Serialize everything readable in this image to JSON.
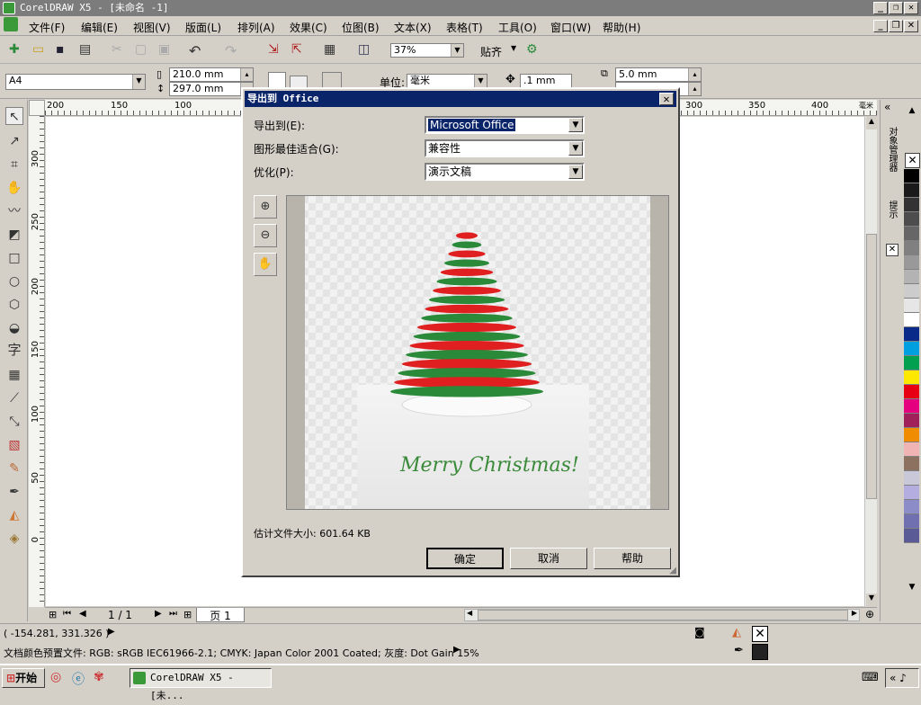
{
  "window": {
    "title": "CorelDRAW X5 - [未命名 -1]"
  },
  "menu": [
    "文件(F)",
    "编辑(E)",
    "视图(V)",
    "版面(L)",
    "排列(A)",
    "效果(C)",
    "位图(B)",
    "文本(X)",
    "表格(T)",
    "工具(O)",
    "窗口(W)",
    "帮助(H)"
  ],
  "toolbar": {
    "zoom": "37%",
    "snap_label": "贴齐"
  },
  "propbar": {
    "page_size": "A4",
    "width": "210.0 mm",
    "height": "297.0 mm",
    "units_label": "单位:",
    "units": "毫米",
    "nudge": ".1 mm",
    "dup_x": "5.0 mm"
  },
  "rulers": {
    "h_ticks": [
      "200",
      "150",
      "100",
      "300",
      "350",
      "400"
    ],
    "unit": "毫米",
    "v_ticks": [
      "300",
      "250",
      "200",
      "150",
      "100",
      "50",
      "0"
    ]
  },
  "pagenav": {
    "pages": "1 / 1",
    "tab": "页 1"
  },
  "status": {
    "coords": "( -154.281, 331.326 )",
    "profile": "文档颜色预置文件: RGB: sRGB IEC61966-2.1; CMYK: Japan Color 2001 Coated; 灰度: Dot Gain 15%"
  },
  "docker": {
    "label1": "对象管理器",
    "label2": "提示"
  },
  "taskbar": {
    "start": "开始",
    "task": "CorelDRAW X5 - [未..."
  },
  "dialog": {
    "title": "导出到 Office",
    "export_to_label": "导出到(E):",
    "export_to_value": "Microsoft Office",
    "fit_label": "图形最佳适合(G):",
    "fit_value": "兼容性",
    "optimize_label": "优化(P):",
    "optimize_value": "演示文稿",
    "filesize": "估计文件大小: 601.64 KB",
    "ok": "确定",
    "cancel": "取消",
    "help": "帮助",
    "preview_text": "Merry Christmas!"
  },
  "palette": [
    "#000000",
    "#1a1a1a",
    "#333333",
    "#4d4d4d",
    "#666666",
    "#808080",
    "#999999",
    "#b3b3b3",
    "#cccccc",
    "#e6e6e6",
    "#ffffff",
    "#0a2a8a",
    "#00a0e0",
    "#00a050",
    "#ffe800",
    "#e60012",
    "#e4007f",
    "#a0205a",
    "#f08c00",
    "#f0b4b4",
    "#8c7060",
    "#c8c8d8",
    "#b4aee0",
    "#8c8cc8",
    "#7070b0",
    "#5a5a96"
  ],
  "colors": {
    "tree_red": "#e02020",
    "tree_green": "#2a8a3a",
    "dialog_title": "#0a246a"
  }
}
